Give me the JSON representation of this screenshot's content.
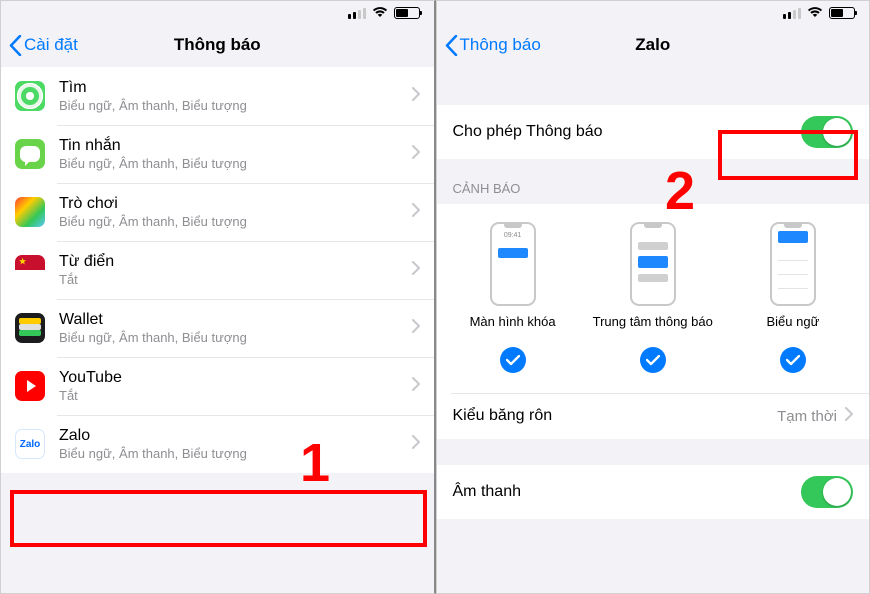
{
  "annotations": {
    "one": "1",
    "two": "2"
  },
  "left": {
    "back": "Cài đặt",
    "title": "Thông báo",
    "items": [
      {
        "title": "Tìm",
        "sub": "Biểu ngữ, Âm thanh, Biểu tượng"
      },
      {
        "title": "Tin nhắn",
        "sub": "Biểu ngữ, Âm thanh, Biểu tượng"
      },
      {
        "title": "Trò chơi",
        "sub": "Biểu ngữ, Âm thanh, Biểu tượng"
      },
      {
        "title": "Từ điển",
        "sub": "Tắt"
      },
      {
        "title": "Wallet",
        "sub": "Biểu ngữ, Âm thanh, Biểu tượng"
      },
      {
        "title": "YouTube",
        "sub": "Tắt"
      },
      {
        "title": "Zalo",
        "sub": "Biểu ngữ, Âm thanh, Biểu tượng"
      }
    ]
  },
  "right": {
    "back": "Thông báo",
    "title": "Zalo",
    "allow_label": "Cho phép Thông báo",
    "alerts_header": "CẢNH BÁO",
    "alert_options": [
      {
        "label": "Màn hình khóa"
      },
      {
        "label": "Trung tâm thông báo"
      },
      {
        "label": "Biểu ngữ"
      }
    ],
    "banner_style_label": "Kiểu băng rôn",
    "banner_style_value": "Tạm thời",
    "sound_label": "Âm thanh",
    "mini_time": "09:41"
  }
}
